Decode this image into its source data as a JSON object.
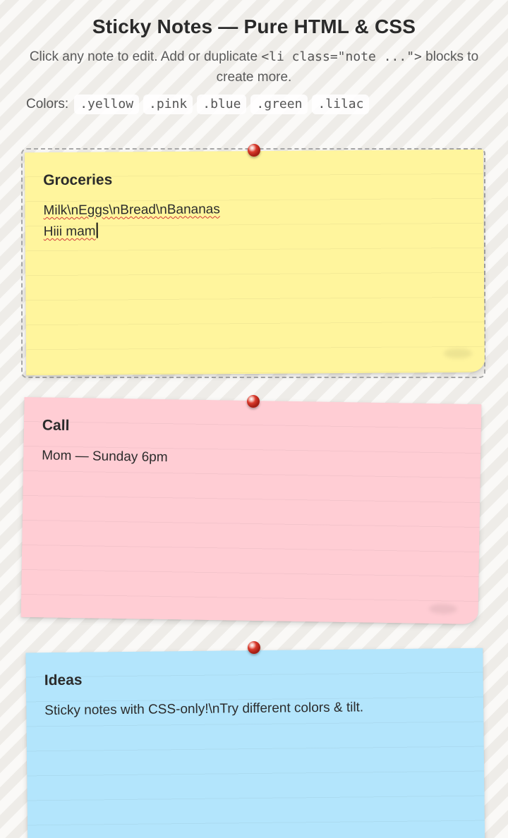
{
  "header": {
    "title": "Sticky Notes — Pure HTML & CSS",
    "subtitle_part1": "Click any note to edit. Add or duplicate ",
    "subtitle_code": "<li class=\"note ...\">",
    "subtitle_part2": " blocks to create more."
  },
  "colors": {
    "label": "Colors:",
    "chips": [
      ".yellow",
      ".pink",
      ".blue",
      ".green",
      ".lilac"
    ]
  },
  "notes": [
    {
      "color": "#fff59d",
      "title": "Groceries",
      "line1": "Milk\\nEggs\\nBread\\nBananas",
      "line2": "Hiii mam",
      "focused": true
    },
    {
      "color": "#ffcdd4",
      "title": "Call",
      "line1": "Mom — Sunday 6pm"
    },
    {
      "color": "#b3e5fc",
      "title": "Ideas",
      "line1": "Sticky notes with CSS-only!\\nTry different colors & tilt."
    }
  ],
  "pin_color": "#d9392b"
}
